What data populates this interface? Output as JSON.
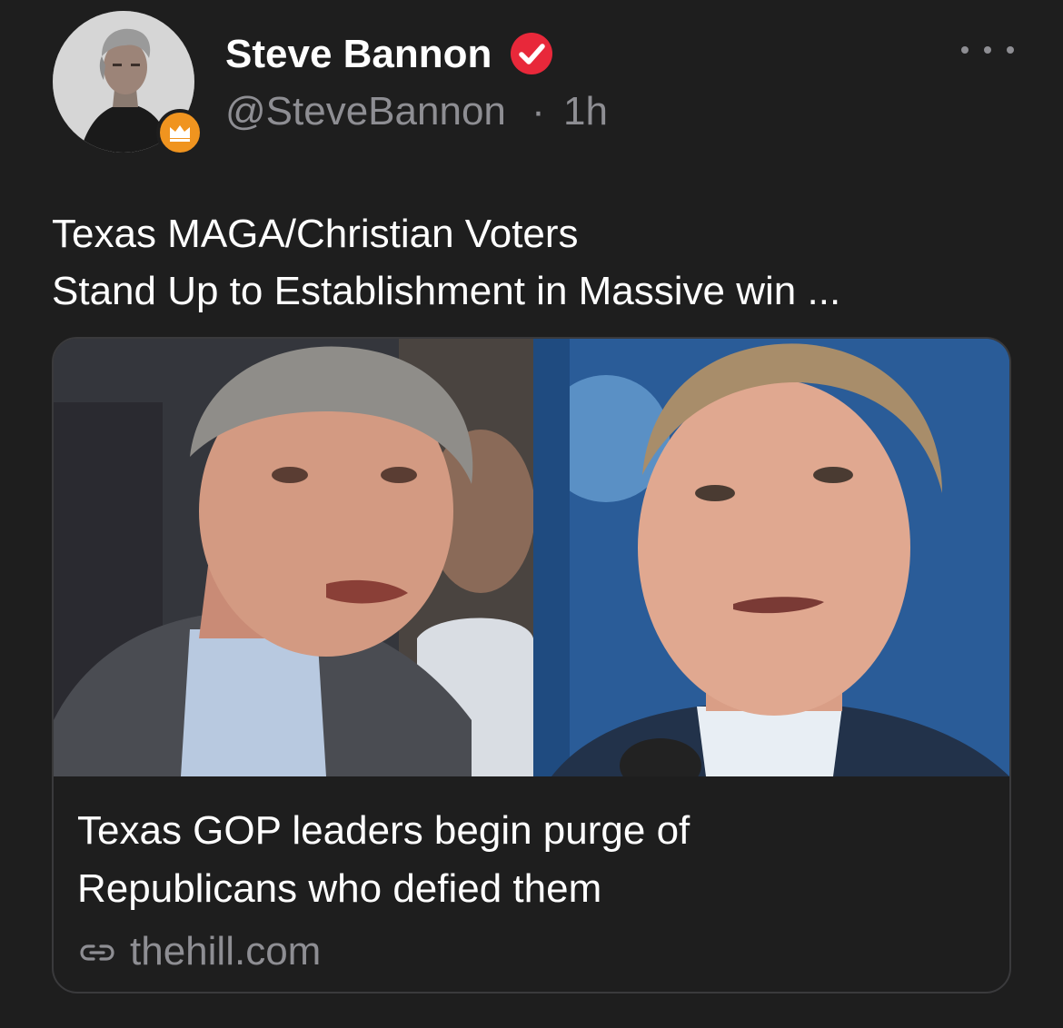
{
  "post": {
    "author": {
      "display_name": "Steve Bannon",
      "handle": "@SteveBannon",
      "separator": "·",
      "time_ago": "1h",
      "verified_icon": "verified-check-icon",
      "badge_icon": "crown-badge-icon",
      "verified_color": "#e8283a",
      "badge_color": "#f0941f"
    },
    "more_icon": "more-horizontal-icon",
    "text_lines": [
      "Texas MAGA/Christian Voters",
      "Stand Up to Establishment in Massive win ..."
    ],
    "link_card": {
      "title_lines": [
        "Texas GOP leaders begin purge of",
        "Republicans who defied them"
      ],
      "domain": "thehill.com",
      "link_icon": "link-icon"
    }
  }
}
